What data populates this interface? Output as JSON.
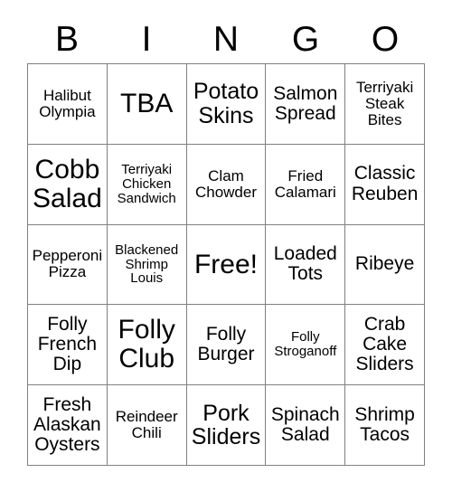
{
  "card": {
    "title_letters": [
      "B",
      "I",
      "N",
      "G",
      "O"
    ],
    "columns": 5,
    "rows": 5,
    "free_space": {
      "row": 2,
      "col": 2,
      "label": "Free!"
    },
    "colors": {
      "background": "#ffffff",
      "grid_line": "#808080",
      "text": "#000000"
    },
    "cells": [
      {
        "text": "Halibut Olympia",
        "size": "sm"
      },
      {
        "text": "TBA",
        "size": "xl"
      },
      {
        "text": "Potato Skins",
        "size": "lg"
      },
      {
        "text": "Salmon Spread",
        "size": "md"
      },
      {
        "text": "Terriyaki Steak Bites",
        "size": "sm"
      },
      {
        "text": "Cobb Salad",
        "size": "xl"
      },
      {
        "text": "Terriyaki Chicken Sandwich",
        "size": "xs"
      },
      {
        "text": "Clam Chowder",
        "size": "sm"
      },
      {
        "text": "Fried Calamari",
        "size": "sm"
      },
      {
        "text": "Classic Reuben",
        "size": "md"
      },
      {
        "text": "Pepperoni Pizza",
        "size": "sm"
      },
      {
        "text": "Blackened Shrimp Louis",
        "size": "xs"
      },
      {
        "text": "Free!",
        "size": "free"
      },
      {
        "text": "Loaded Tots",
        "size": "md"
      },
      {
        "text": "Ribeye",
        "size": "md"
      },
      {
        "text": "Folly French Dip",
        "size": "md"
      },
      {
        "text": "Folly Club",
        "size": "xl"
      },
      {
        "text": "Folly Burger",
        "size": "md"
      },
      {
        "text": "Folly Stroganoff",
        "size": "xs"
      },
      {
        "text": "Crab Cake Sliders",
        "size": "md"
      },
      {
        "text": "Fresh Alaskan Oysters",
        "size": "md"
      },
      {
        "text": "Reindeer Chili",
        "size": "sm"
      },
      {
        "text": "Pork Sliders",
        "size": "lg"
      },
      {
        "text": "Spinach Salad",
        "size": "md"
      },
      {
        "text": "Shrimp Tacos",
        "size": "md"
      }
    ]
  }
}
